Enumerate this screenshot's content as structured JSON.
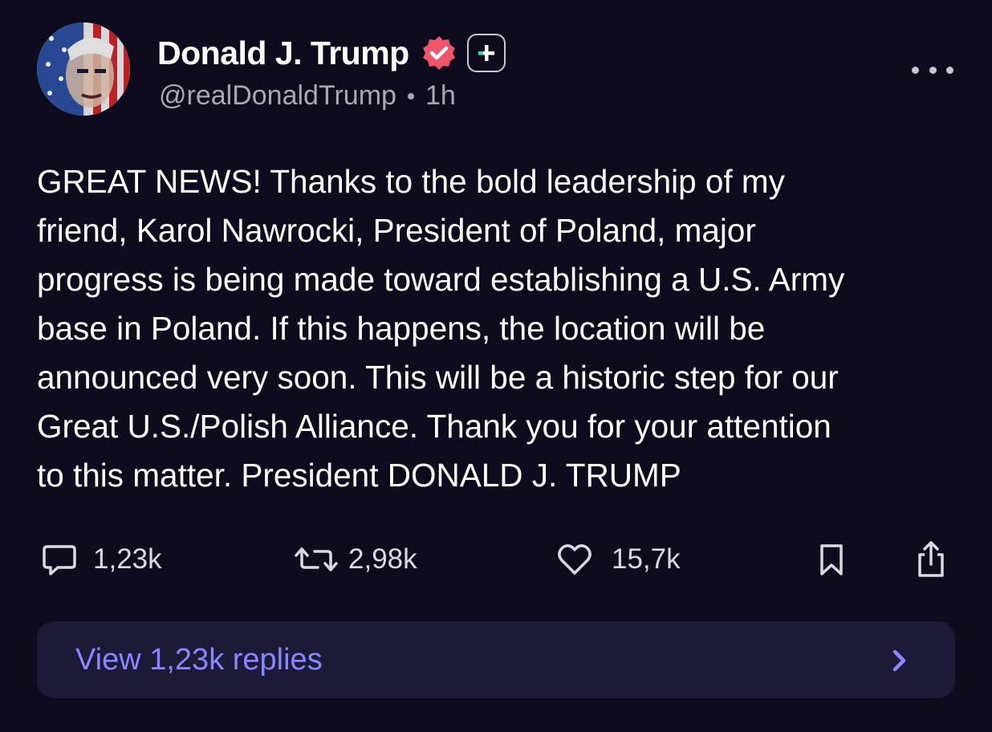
{
  "author": {
    "display_name": "Donald J. Trump",
    "handle": "@realDonaldTrump",
    "time_ago": "1h",
    "verified": true,
    "verified_color": "#f0566b"
  },
  "post": {
    "text": "GREAT NEWS! Thanks to the bold leadership of my\nfriend, Karol Nawrocki, President of Poland, major\nprogress is being made toward establishing a U.S. Army\nbase in Poland. If this happens, the location will be\nannounced very soon. This will be a historic step for our\nGreat U.S./Polish Alliance. Thank you for your attention\nto this matter. President DONALD J. TRUMP"
  },
  "actions": {
    "replies_count": "1,23k",
    "reposts_count": "2,98k",
    "likes_count": "15,7k",
    "icons": [
      "comment-icon",
      "repost-icon",
      "heart-icon",
      "bookmark-icon",
      "share-icon"
    ]
  },
  "replies_bar": {
    "label": "View 1,23k replies",
    "accent": "#8b86ff"
  },
  "colors": {
    "background": "#0e0b1f",
    "muted_text": "#a8a8b4",
    "card": "#1d1a38"
  }
}
